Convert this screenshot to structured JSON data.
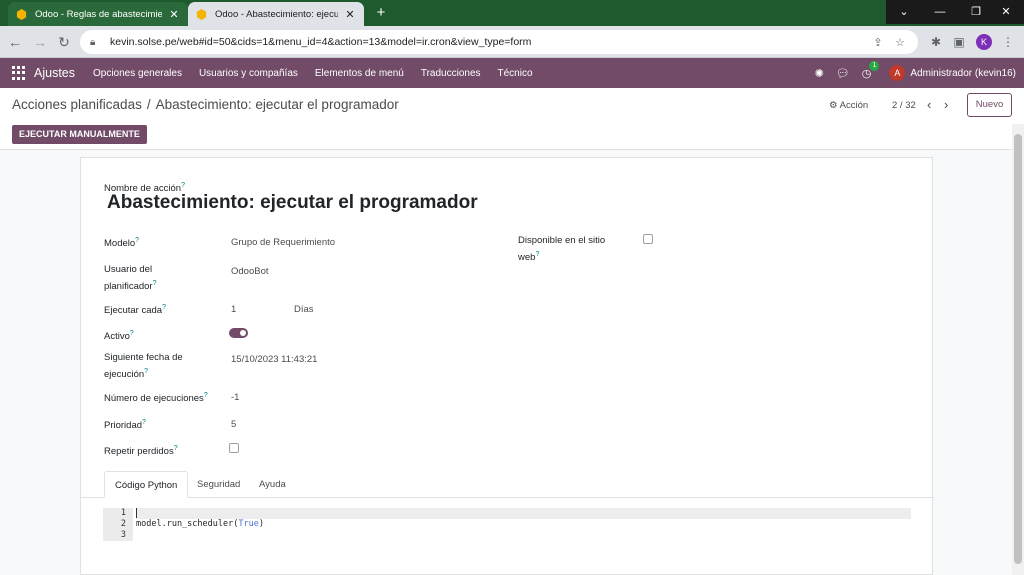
{
  "browser": {
    "tabs": [
      {
        "title": "Odoo - Reglas de abastecimient",
        "active": false
      },
      {
        "title": "Odoo - Abastecimiento: ejecuta",
        "active": true
      }
    ],
    "url": "kevin.solse.pe/web#id=50&cids=1&menu_id=4&action=13&model=ir.cron&view_type=form",
    "profile_initial": "K"
  },
  "navbar": {
    "brand": "Ajustes",
    "menu": [
      "Opciones generales",
      "Usuarios y compañías",
      "Elementos de menú",
      "Traducciones",
      "Técnico"
    ],
    "activity_count": "1",
    "avatar_initial": "A",
    "user": "Administrador (kevin16)"
  },
  "control": {
    "breadcrumb_parent": "Acciones planificadas",
    "breadcrumb_separator": "/",
    "breadcrumb_current": "Abastecimiento: ejecutar el programador",
    "action_label": "Acción",
    "pager": "2 / 32",
    "new_label": "Nuevo",
    "run_label": "EJECUTAR MANUALMENTE"
  },
  "form": {
    "name_label": "Nombre de acción",
    "name_value": "Abastecimiento: ejecutar el programador",
    "fields": {
      "modelo_label": "Modelo",
      "modelo_value": "Grupo de Requerimiento",
      "usuario_label": "Usuario del planificador",
      "usuario_value": "OdooBot",
      "ejecutar_label": "Ejecutar cada",
      "ejecutar_value": "1",
      "ejecutar_unit": "Días",
      "activo_label": "Activo",
      "siguiente_label": "Siguiente fecha de ejecución",
      "siguiente_value": "15/10/2023 11:43:21",
      "numero_label": "Número de ejecuciones",
      "numero_value": "-1",
      "prioridad_label": "Prioridad",
      "prioridad_value": "5",
      "repetir_label": "Repetir perdidos",
      "disponible_label": "Disponible en el sitio web"
    },
    "activo": true,
    "repetir_perdidos": false,
    "disponible_web": false,
    "help_marker": "?"
  },
  "notebook": {
    "tabs": [
      "Código Python",
      "Seguridad",
      "Ayuda"
    ],
    "active_tab": "Código Python"
  },
  "code": {
    "line_numbers": [
      "1",
      "2",
      "3"
    ],
    "line2_prefix": "model.run_scheduler(",
    "line2_keyword": "True",
    "line2_suffix": ")"
  }
}
